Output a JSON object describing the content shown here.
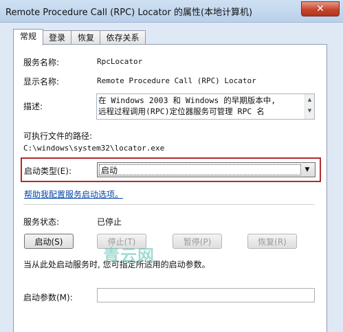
{
  "window": {
    "title": "Remote Procedure Call (RPC) Locator 的属性(本地计算机)",
    "close_glyph": "✕"
  },
  "tabs": [
    {
      "label": "常规"
    },
    {
      "label": "登录"
    },
    {
      "label": "恢复"
    },
    {
      "label": "依存关系"
    }
  ],
  "general": {
    "service_name_label": "服务名称:",
    "service_name_value": "RpcLocator",
    "display_name_label": "显示名称:",
    "display_name_value": "Remote Procedure Call (RPC) Locator",
    "description_label": "描述:",
    "description_value": "在 Windows 2003 和 Windows 的早期版本中,\n远程过程调用(RPC)定位器服务可管理 RPC 名",
    "exe_path_label": "可执行文件的路径:",
    "exe_path_value": "C:\\windows\\system32\\locator.exe",
    "startup_type_label": "启动类型(E):",
    "startup_type_value": "启动",
    "help_link": "帮助我配置服务启动选项。",
    "service_status_label": "服务状态:",
    "service_status_value": "已停止",
    "buttons": {
      "start": "启动(S)",
      "stop": "停止(T)",
      "pause": "暂停(P)",
      "resume": "恢复(R)"
    },
    "hint_text": "当从此处启动服务时, 您可指定所适用的启动参数。",
    "start_params_label": "启动参数(M):",
    "start_params_value": ""
  },
  "watermark": "青云网",
  "colors": {
    "highlight_border": "#b32a2a",
    "link": "#0645ad",
    "close_button": "#c6442b"
  }
}
